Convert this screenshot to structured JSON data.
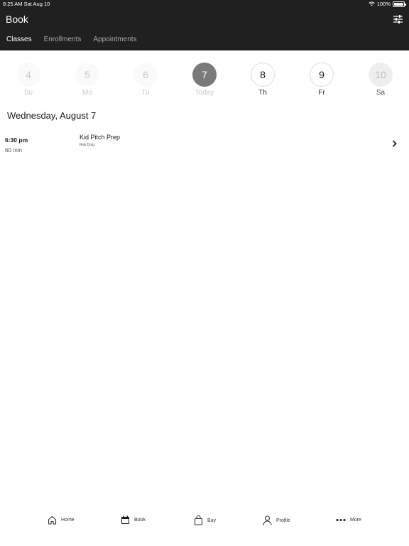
{
  "status_bar": {
    "time_date": "8:25 AM  Sat Aug 10",
    "battery": "100%"
  },
  "header": {
    "title": "Book",
    "filter_icon": "sliders-icon"
  },
  "tabs": [
    {
      "label": "Classes",
      "active": true
    },
    {
      "label": "Enrollments",
      "active": false
    },
    {
      "label": "Appointments",
      "active": false
    }
  ],
  "days": [
    {
      "number": "4",
      "label": "Su",
      "state": "past"
    },
    {
      "number": "5",
      "label": "Mo",
      "state": "past"
    },
    {
      "number": "6",
      "label": "Tu",
      "state": "past"
    },
    {
      "number": "7",
      "label": "Today",
      "state": "today"
    },
    {
      "number": "8",
      "label": "Th",
      "state": "future"
    },
    {
      "number": "9",
      "label": "Fr",
      "state": "future"
    },
    {
      "number": "10",
      "label": "Sa",
      "state": "faded"
    }
  ],
  "date_heading": "Wednesday, August 7",
  "classes": [
    {
      "time": "6:30 pm",
      "duration": "60 min",
      "name": "Kid Pitch Prep",
      "instructor": "Rob Doig"
    }
  ],
  "bottom_nav": [
    {
      "label": "Home",
      "icon": "home-icon"
    },
    {
      "label": "Book",
      "icon": "calendar-icon"
    },
    {
      "label": "Buy",
      "icon": "shopping-bag-icon"
    },
    {
      "label": "Profile",
      "icon": "person-icon"
    },
    {
      "label": "More",
      "icon": "more-dots-icon"
    }
  ]
}
